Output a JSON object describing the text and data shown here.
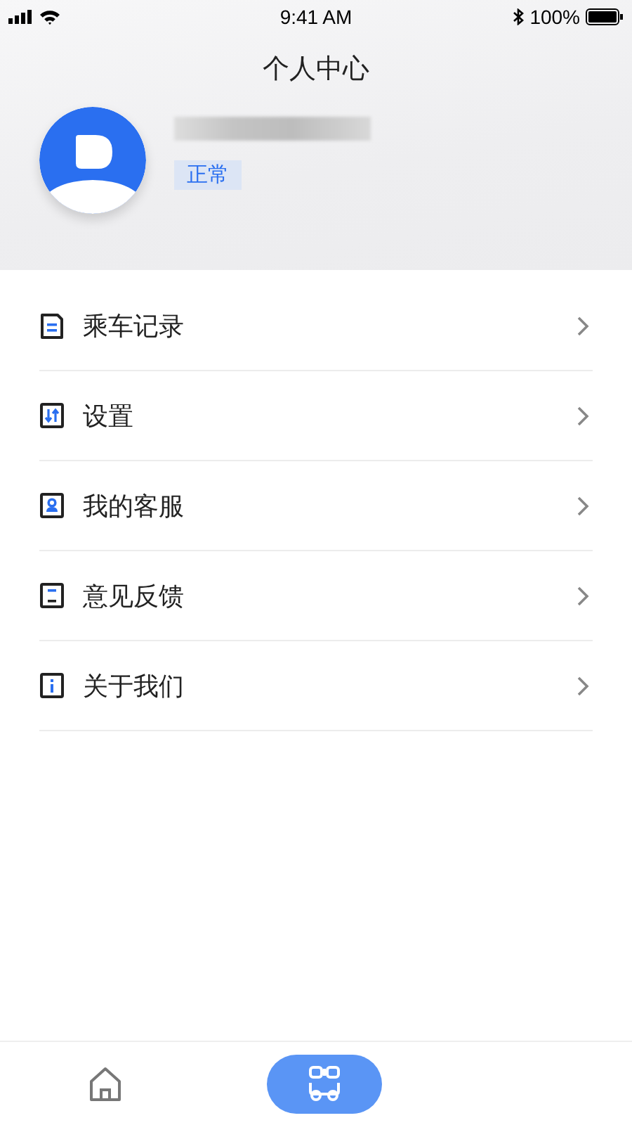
{
  "status_bar": {
    "time": "9:41 AM",
    "battery": "100%"
  },
  "header": {
    "title": "个人中心",
    "badge": "正常"
  },
  "menu": [
    {
      "label": "乘车记录",
      "kind": "record"
    },
    {
      "label": "设置",
      "kind": "settings"
    },
    {
      "label": "我的客服",
      "kind": "service"
    },
    {
      "label": "意见反馈",
      "kind": "feedback"
    },
    {
      "label": "关于我们",
      "kind": "about"
    }
  ],
  "tabs": [
    {
      "kind": "home",
      "selected": false
    },
    {
      "kind": "bus",
      "selected": true
    }
  ]
}
